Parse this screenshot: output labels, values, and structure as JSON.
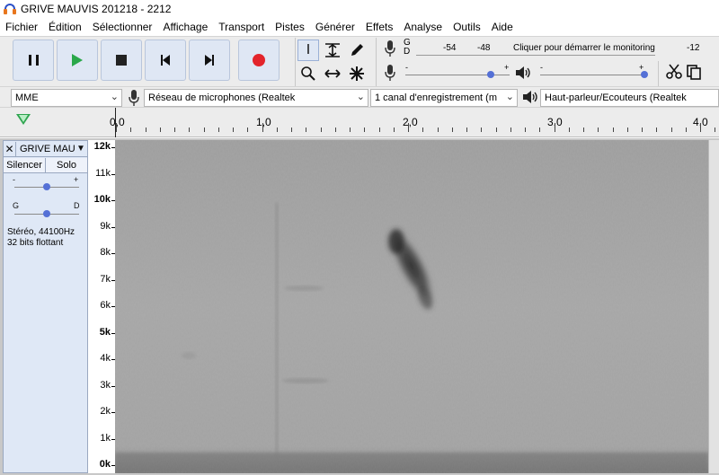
{
  "window": {
    "title": "GRIVE MAUVIS 201218 - 2212"
  },
  "menu": {
    "items": [
      "Fichier",
      "Édition",
      "Sélectionner",
      "Affichage",
      "Transport",
      "Pistes",
      "Générer",
      "Effets",
      "Analyse",
      "Outils",
      "Aide"
    ]
  },
  "meters": {
    "record_label_g": "G",
    "record_label_d": "D",
    "ticks": [
      "-54",
      "-48",
      "-12"
    ],
    "monitor_text": "Cliquer pour démarrer le monitoring",
    "slider_minus": "-",
    "slider_plus": "+",
    "record_volume": 0.82,
    "playback_volume": 1.0
  },
  "devices": {
    "host": "MME",
    "input": "Réseau de microphones (Realtek",
    "channels": "1 canal d'enregistrement (m",
    "output": "Haut-parleur/Ecouteurs (Realtek"
  },
  "timeline": {
    "labels": [
      "0,0",
      "1,0",
      "2,0",
      "3,0",
      "4,0"
    ]
  },
  "track": {
    "name": "GRIVE MAU",
    "mute": "Silencer",
    "solo": "Solo",
    "gain_minus": "-",
    "gain_plus": "+",
    "pan_left": "G",
    "pan_right": "D",
    "format_line1": "Stéréo, 44100Hz",
    "format_line2": "32 bits flottant",
    "gain": 0.5,
    "pan": 0.5
  },
  "freq_scale": {
    "labels": [
      "12k",
      "11k",
      "10k",
      "9k",
      "8k",
      "7k",
      "6k",
      "5k",
      "4k",
      "3k",
      "2k",
      "1k",
      "0k"
    ],
    "bold": [
      "12k",
      "10k",
      "5k",
      "0k"
    ]
  },
  "icons": {
    "pause": "pause-icon",
    "play": "play-icon",
    "stop": "stop-icon",
    "skip_start": "skip-start-icon",
    "skip_end": "skip-end-icon",
    "record": "record-icon",
    "selection_tool": "i-beam-icon",
    "envelope_tool": "envelope-icon",
    "draw_tool": "pencil-icon",
    "zoom_tool": "magnifier-icon",
    "timeshift_tool": "timeshift-icon",
    "multi_tool": "multi-tool-icon",
    "cut": "scissors-icon",
    "copy": "copy-icon"
  },
  "colors": {
    "play_green": "#2aa84a",
    "record_red": "#e3242b",
    "slider_blue": "#5470d6",
    "track_panel": "#dfe8f6"
  }
}
